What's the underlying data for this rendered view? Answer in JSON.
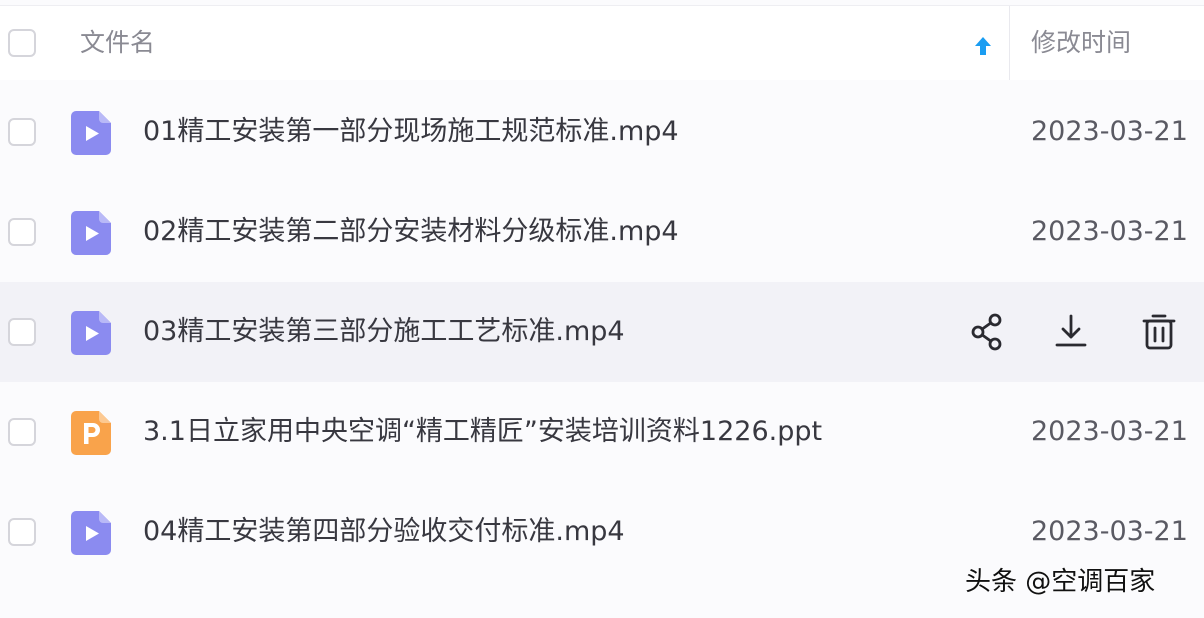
{
  "header": {
    "name_column": "文件名",
    "time_column": "修改时间",
    "sort_direction": "ascending"
  },
  "files": [
    {
      "name": "01精工安装第一部分现场施工规范标准.mp4",
      "type": "video",
      "modified": "2023-03-21",
      "hovered": false
    },
    {
      "name": "02精工安装第二部分安装材料分级标准.mp4",
      "type": "video",
      "modified": "2023-03-21",
      "hovered": false
    },
    {
      "name": "03精工安装第三部分施工工艺标准.mp4",
      "type": "video",
      "modified": "",
      "hovered": true
    },
    {
      "name": "3.1日立家用中央空调“精工精匠”安装培训资料1226.ppt",
      "type": "ppt",
      "modified": "2023-03-21",
      "hovered": false
    },
    {
      "name": "04精工安装第四部分验收交付标准.mp4",
      "type": "video",
      "modified": "2023-03-21",
      "hovered": false
    }
  ],
  "row_actions": [
    "share-icon",
    "download-icon",
    "delete-icon"
  ],
  "watermark": "头条 @空调百家",
  "colors": {
    "video_icon": "#8b8bf0",
    "ppt_icon": "#f9a34b",
    "sort_arrow": "#1a9df2",
    "hover_row": "#f2f2f7"
  }
}
